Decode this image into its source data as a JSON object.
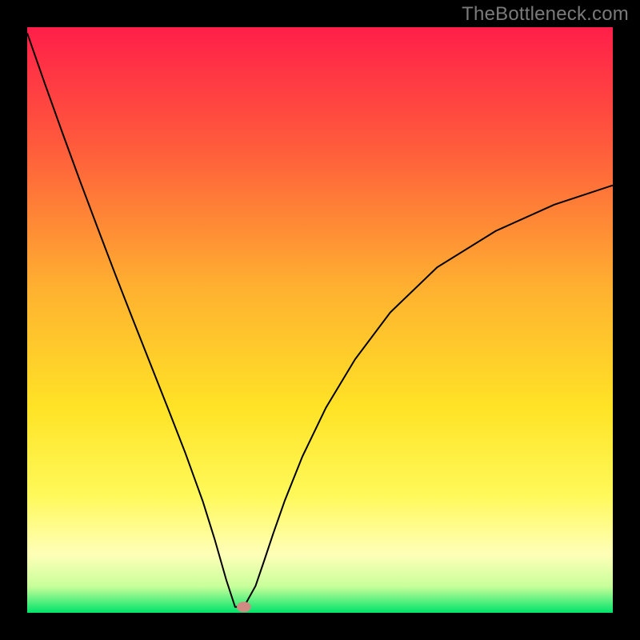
{
  "attribution": "TheBottleneck.com",
  "chart_data": {
    "type": "line",
    "title": "",
    "xlabel": "",
    "ylabel": "",
    "xlim": [
      0,
      100
    ],
    "ylim": [
      0,
      100
    ],
    "background": {
      "type": "vertical-gradient",
      "stops": [
        {
          "pos": 0.0,
          "color": "#ff1f49"
        },
        {
          "pos": 0.2,
          "color": "#ff5a3c"
        },
        {
          "pos": 0.45,
          "color": "#ffb230"
        },
        {
          "pos": 0.65,
          "color": "#ffe326"
        },
        {
          "pos": 0.8,
          "color": "#fff95a"
        },
        {
          "pos": 0.9,
          "color": "#ffffb8"
        },
        {
          "pos": 0.955,
          "color": "#c8ff9a"
        },
        {
          "pos": 1.0,
          "color": "#00e36a"
        }
      ]
    },
    "series": [
      {
        "name": "bottleneck-curve",
        "color": "#000000",
        "x": [
          0.0,
          3.0,
          6.0,
          9.0,
          12.0,
          15.0,
          18.0,
          21.0,
          24.0,
          27.0,
          30.0,
          32.0,
          34.0,
          35.5,
          36.5,
          37.0,
          39.0,
          40.5,
          42.0,
          44.0,
          47.0,
          51.0,
          56.0,
          62.0,
          70.0,
          80.0,
          90.0,
          100.0
        ],
        "y": [
          99.0,
          90.4,
          82.0,
          73.8,
          65.8,
          57.9,
          50.2,
          42.6,
          35.0,
          27.3,
          19.0,
          12.6,
          5.6,
          1.0,
          1.0,
          1.0,
          4.6,
          9.0,
          13.5,
          19.2,
          26.7,
          35.0,
          43.3,
          51.3,
          59.0,
          65.2,
          69.7,
          73.0
        ]
      }
    ],
    "marker": {
      "name": "optimal-point",
      "x": 37.0,
      "y": 1.0,
      "rx": 1.2,
      "ry": 0.9,
      "color": "#cf8b82"
    }
  }
}
